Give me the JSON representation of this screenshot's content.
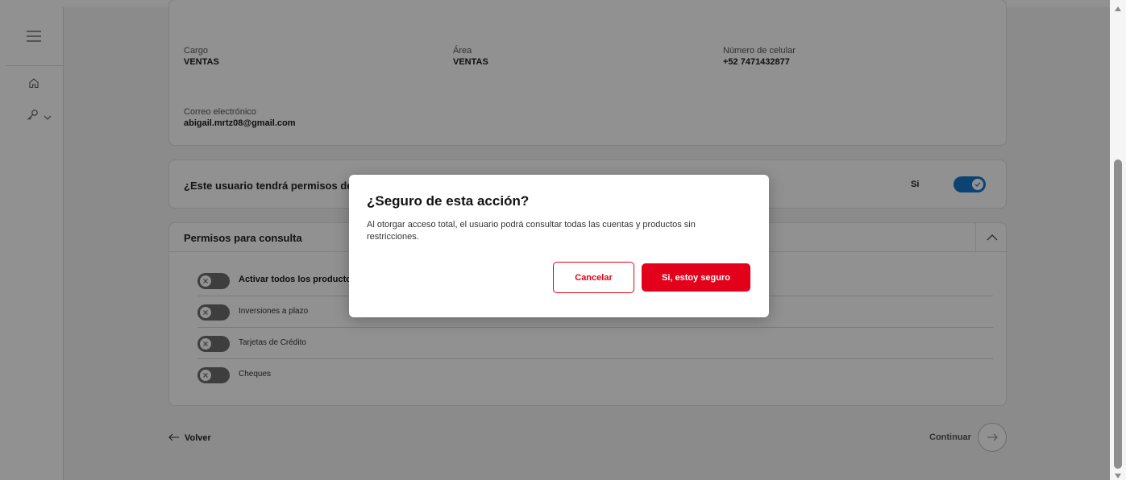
{
  "sidebar": {
    "menu_icon": "hamburger-menu-icon",
    "home_icon": "home-icon",
    "tools_icon": "key-icon",
    "tools_caret": "chevron-down-icon"
  },
  "user_info": {
    "cargo": {
      "label": "Cargo",
      "value": "VENTAS"
    },
    "area": {
      "label": "Área",
      "value": "VENTAS"
    },
    "celular": {
      "label": "Número de celular",
      "value": "+52 7471432877"
    },
    "correo": {
      "label": "Correo electrónico",
      "value": "abigail.mrtz08@gmail.com"
    }
  },
  "permissions_question": {
    "text": "¿Este usuario tendrá permisos de c",
    "toggle_label": "Si",
    "toggle_on": true
  },
  "consulta": {
    "title": "Permisos para consulta",
    "rows": [
      {
        "label": "Activar todos los producto",
        "bold": true,
        "on": false
      },
      {
        "label": "Inversiones a plazo",
        "bold": false,
        "on": false
      },
      {
        "label": "Tarjetas de Crédito",
        "bold": false,
        "on": false
      },
      {
        "label": "Cheques",
        "bold": false,
        "on": false
      }
    ]
  },
  "footer_nav": {
    "back_label": "Volver",
    "continue_label": "Continuar"
  },
  "modal": {
    "title": "¿Seguro de esta acción?",
    "body": "Al otorgar acceso total, el usuario podrá consultar todas las cuentas y productos sin restricciones.",
    "cancel_label": "Cancelar",
    "confirm_label": "Si, estoy seguro"
  },
  "colors": {
    "brand_red": "#e3001b",
    "toggle_on_blue": "#1477c9",
    "toggle_off_gray": "#6e6e6e",
    "overlay": "rgba(0,0,0,0.43)"
  }
}
